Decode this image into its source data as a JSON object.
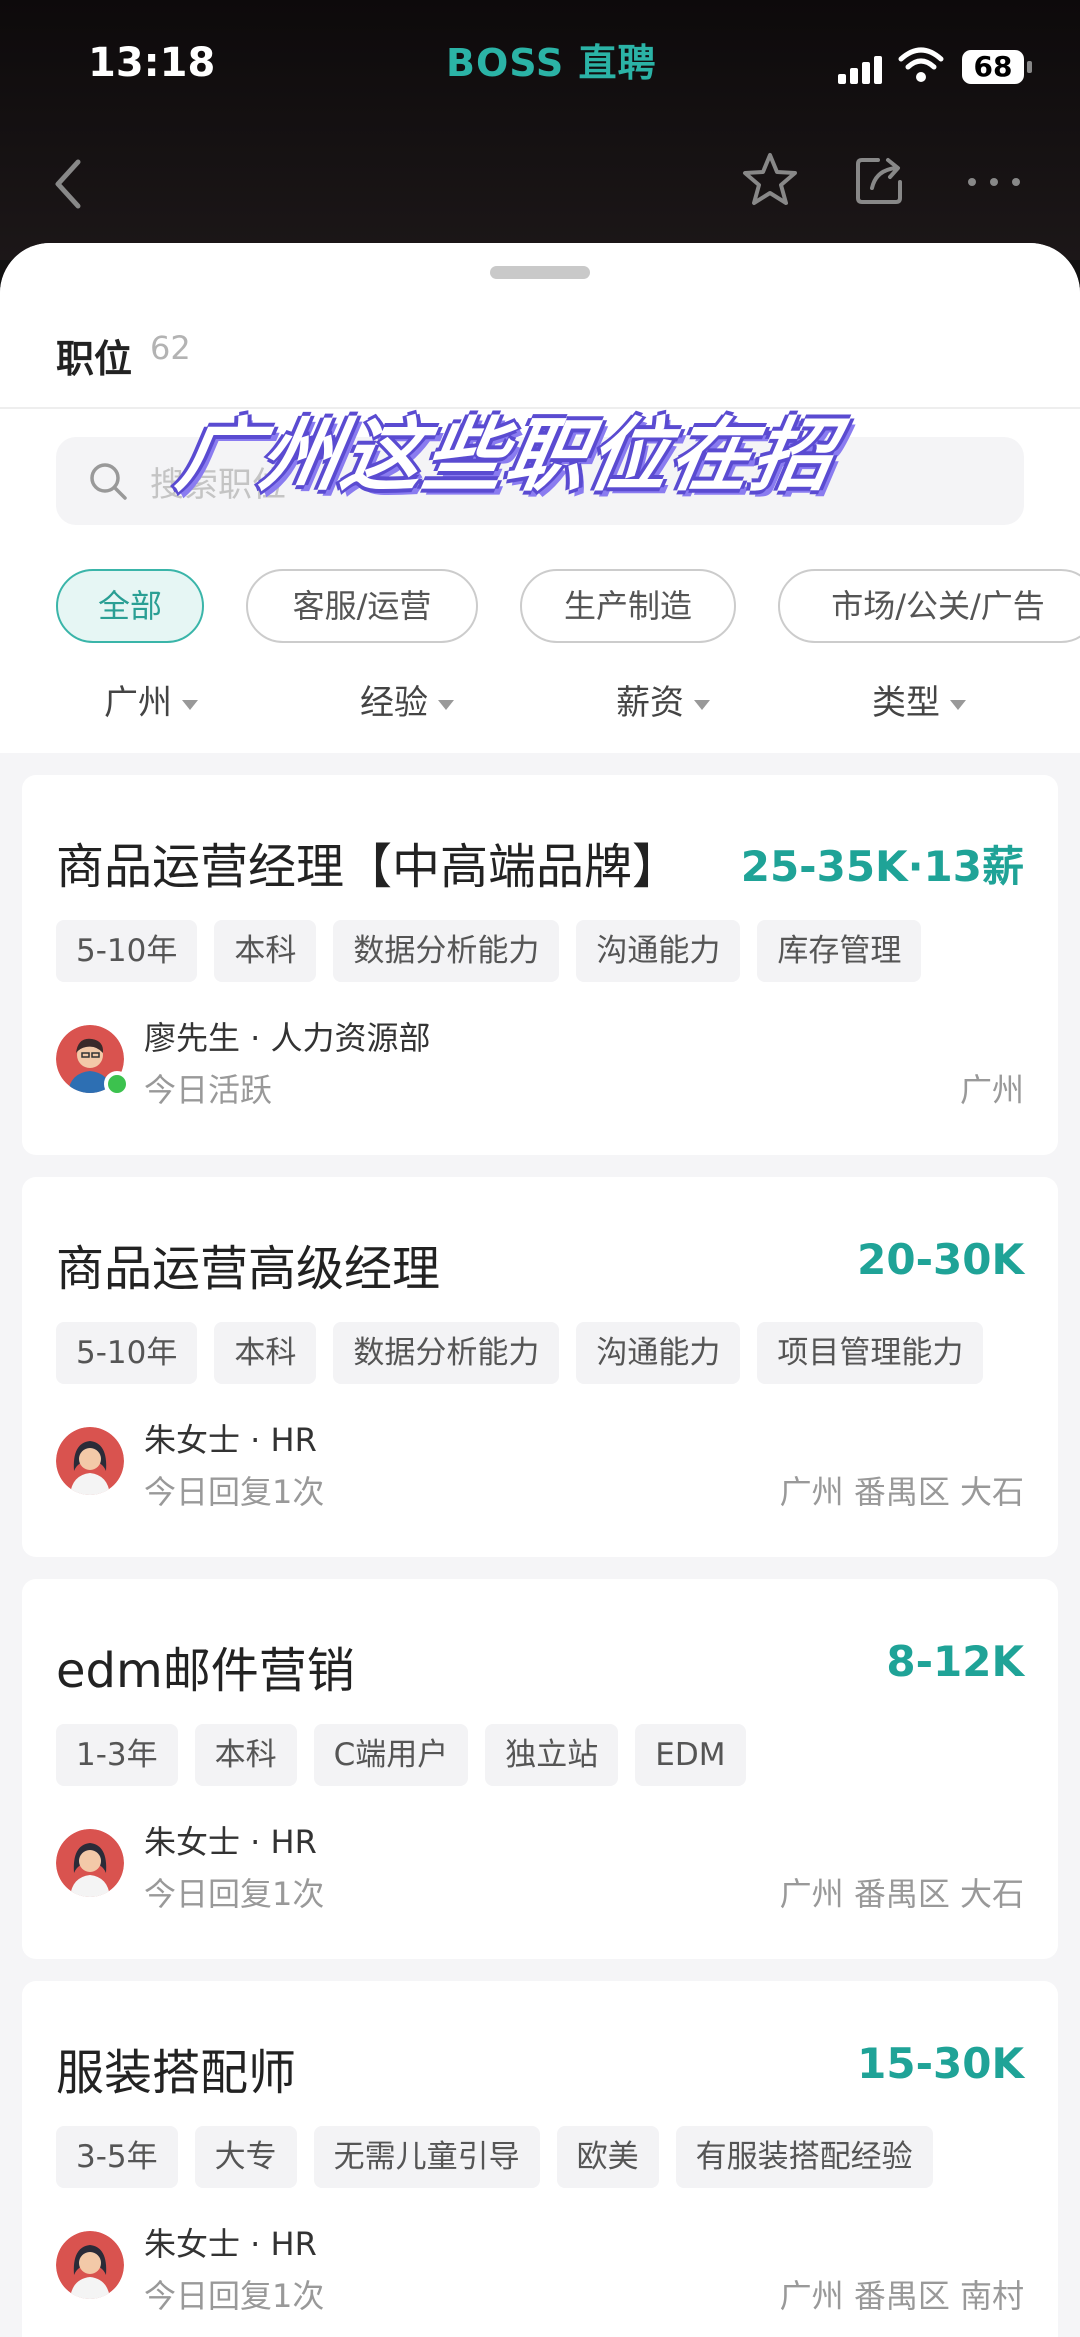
{
  "status_bar": {
    "time": "13:18",
    "app_brand": "BOSS 直聘",
    "battery": "68"
  },
  "nav": {
    "back_icon": "chevron-left-icon",
    "favorite_icon": "star-icon",
    "share_icon": "share-icon",
    "more_icon": "more-icon"
  },
  "sheet": {
    "title": "职位",
    "count": "62",
    "banner": "广州这些职位在招",
    "search_placeholder": "搜索职位",
    "categories": [
      "全部",
      "客服/运营",
      "生产制造",
      "市场/公关/广告"
    ],
    "filters": [
      "广州",
      "经验",
      "薪资",
      "类型"
    ]
  },
  "jobs": [
    {
      "title": "商品运营经理【中高端品牌】",
      "salary": "25-35K·13薪",
      "tags": [
        "5-10年",
        "本科",
        "数据分析能力",
        "沟通能力",
        "库存管理"
      ],
      "recruiter": "廖先生 · 人力资源部",
      "activity": "今日活跃",
      "location": "广州"
    },
    {
      "title": "商品运营高级经理",
      "salary": "20-30K",
      "tags": [
        "5-10年",
        "本科",
        "数据分析能力",
        "沟通能力",
        "项目管理能力"
      ],
      "recruiter": "朱女士 · HR",
      "activity": "今日回复1次",
      "location": "广州 番禺区 大石"
    },
    {
      "title": "edm邮件营销",
      "salary": "8-12K",
      "tags": [
        "1-3年",
        "本科",
        "C端用户",
        "独立站",
        "EDM"
      ],
      "recruiter": "朱女士 · HR",
      "activity": "今日回复1次",
      "location": "广州 番禺区 大石"
    },
    {
      "title": "服装搭配师",
      "salary": "15-30K",
      "tags": [
        "3-5年",
        "大专",
        "无需儿童引导",
        "欧美",
        "有服装搭配经验"
      ],
      "recruiter": "朱女士 · HR",
      "activity": "今日回复1次",
      "location": "广州 番禺区 南村"
    }
  ],
  "colors": {
    "accent": "#1fa397",
    "brand": "#2bb3a6",
    "banner_outline": "#5a4bd1"
  }
}
